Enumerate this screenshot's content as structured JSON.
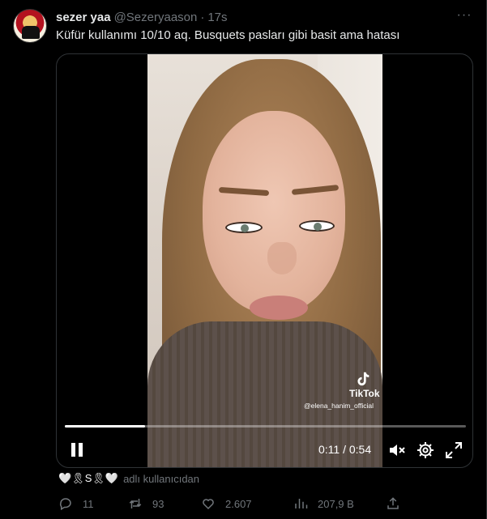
{
  "tweet": {
    "author_name": "sezer yaa",
    "author_handle": "@Sezeryaason",
    "separator": "·",
    "time": "17s",
    "more_label": "···",
    "text": "Küfür kullanımı 10/10 aq. Busquets pasları gibi basit ama hatası"
  },
  "video": {
    "tiktok_label": "TikTok",
    "tiktok_handle": "@elena_hanim_official",
    "current_time": "0:11",
    "duration": "0:54",
    "time_display": "0:11 / 0:54",
    "progress": 0.2,
    "state": "playing"
  },
  "attribution": {
    "emoji": "🤍🎗S🎗🤍",
    "text": "adlı kullanıcıdan"
  },
  "actions": {
    "replies": "11",
    "retweets": "93",
    "likes": "2.607",
    "views": "207,9 B"
  },
  "colors": {
    "background": "#000000",
    "text_primary": "#e7e9ea",
    "text_secondary": "#71767b",
    "border": "#2f3336"
  },
  "icons": {
    "reply": "reply-icon",
    "retweet": "retweet-icon",
    "like": "heart-icon",
    "views": "views-icon",
    "share": "share-icon",
    "pause": "pause-icon",
    "mute": "mute-icon",
    "settings": "gear-icon",
    "fullscreen": "fullscreen-icon"
  }
}
